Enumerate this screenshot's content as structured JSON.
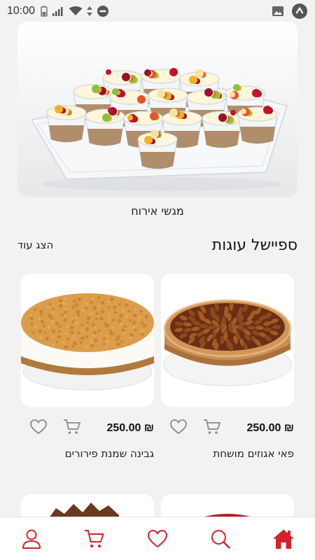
{
  "status_bar": {
    "time": "10:00"
  },
  "hero": {
    "caption": "מגשי אירוח"
  },
  "section": {
    "title": "ספיישל עוגות",
    "show_more": "הצג עוד"
  },
  "products": [
    {
      "name": "פאי אגוזים מושחת",
      "price": "250.00 ₪"
    },
    {
      "name": "גבינה שמנת פירורים",
      "price": "250.00 ₪"
    }
  ],
  "icons": {
    "nav": [
      "user-icon",
      "cart-icon",
      "heart-icon",
      "search-icon",
      "home-icon"
    ],
    "card_actions": [
      "cart-icon",
      "heart-icon"
    ]
  },
  "colors": {
    "accent": "#d3222a",
    "icon_gray": "#8a8a8a",
    "background": "#f2f2f2"
  }
}
